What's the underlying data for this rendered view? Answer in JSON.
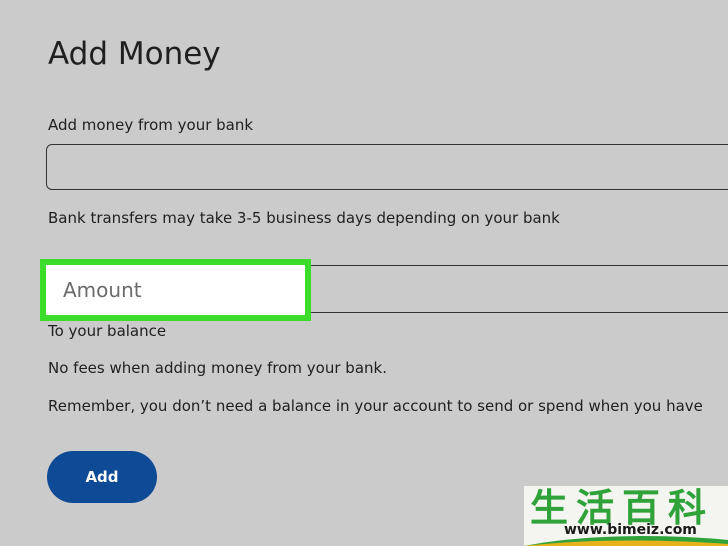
{
  "header": {
    "title": "Add Money"
  },
  "bank_section": {
    "label": "Add money from your bank",
    "input_value": "",
    "note": "Bank transfers may take 3-5 business days depending on your bank"
  },
  "amount_section": {
    "placeholder": "Amount",
    "destination": "To your balance",
    "fees_note": "No fees when adding money from your bank.",
    "reminder": "Remember, you don’t need a balance in your account to send or spend when you have"
  },
  "actions": {
    "add_label": "Add"
  },
  "watermark": {
    "chars": "生活百科",
    "url": "www.bimeiz.com"
  },
  "colors": {
    "background": "#cbcbcb",
    "highlight": "#3cdc2a",
    "button": "#0e4a96"
  }
}
